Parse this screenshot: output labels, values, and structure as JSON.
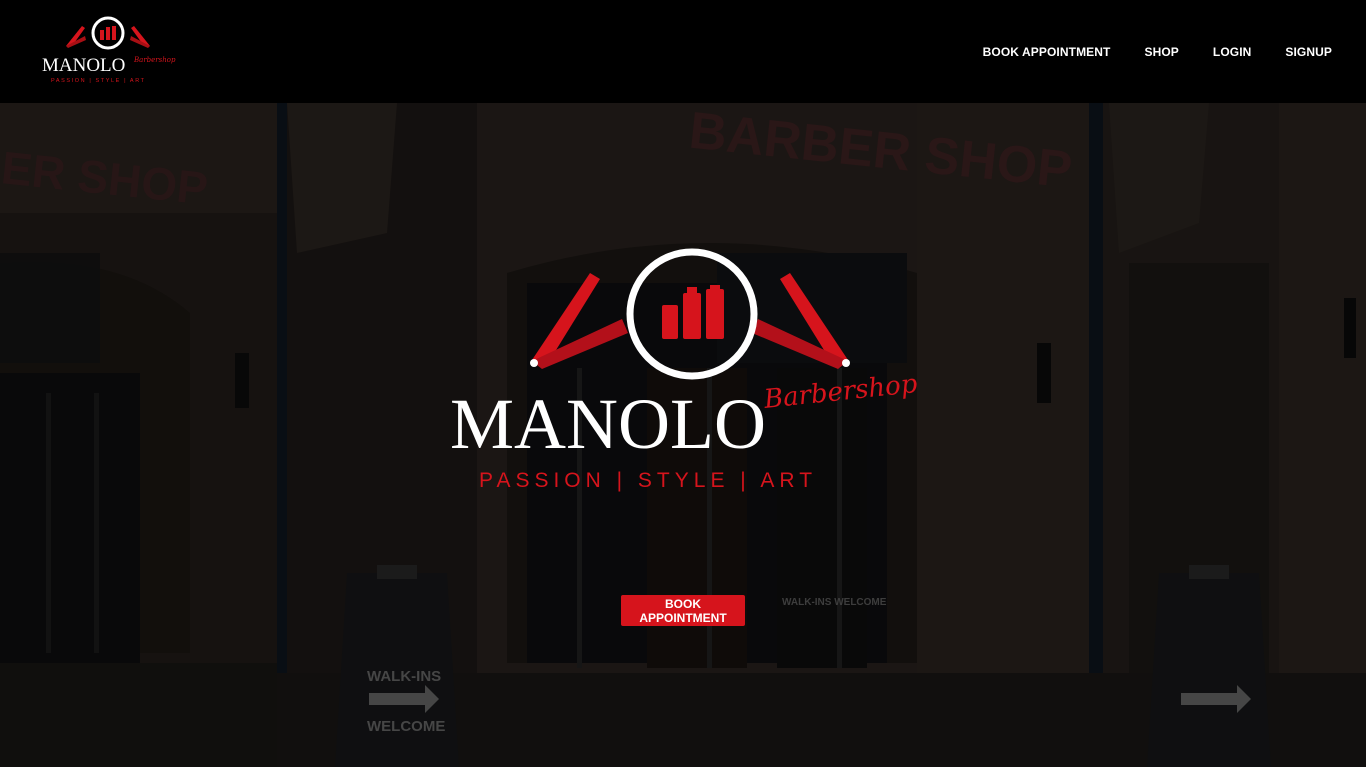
{
  "brand": {
    "name": "MANOLO",
    "script": "Barbershop",
    "tagline": "PASSION | STYLE | ART"
  },
  "nav": {
    "items": [
      {
        "label": "BOOK APPOINTMENT"
      },
      {
        "label": "SHOP"
      },
      {
        "label": "LOGIN"
      },
      {
        "label": "SIGNUP"
      }
    ]
  },
  "hero": {
    "storefront_sign": "BARBER SHOP",
    "sandwich_board": {
      "line1": "WALK-INS",
      "line2": "WELCOME"
    },
    "door_sign": "WALK-INS WELCOME",
    "cta_label": "BOOK APPOINTMENT"
  },
  "colors": {
    "accent_red": "#d6141c",
    "header_bg": "#000000"
  }
}
